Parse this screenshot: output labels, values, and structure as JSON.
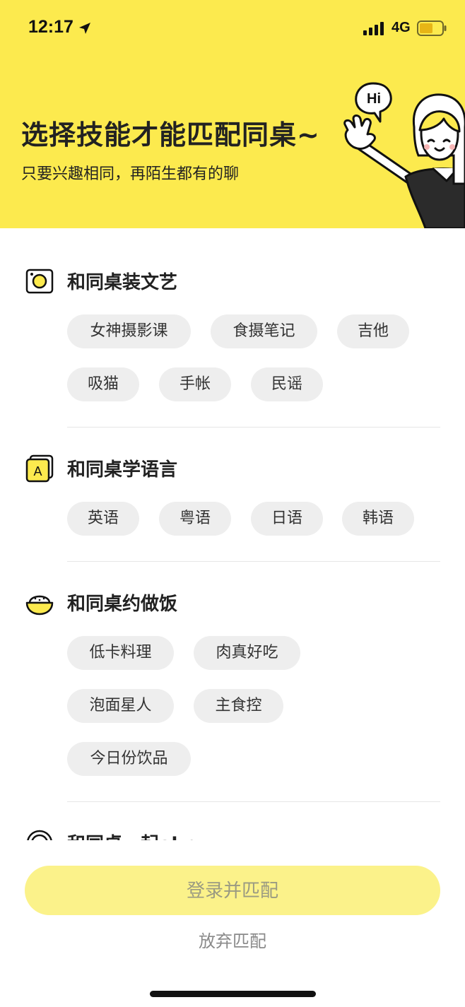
{
  "status_bar": {
    "time": "12:17",
    "network": "4G"
  },
  "header": {
    "title": "选择技能才能匹配同桌~",
    "subtitle": "只要兴趣相同，再陌生都有的聊",
    "mascot_bubble": "Hi"
  },
  "sections": [
    {
      "title": "和同桌装文艺",
      "icon": "camera-icon",
      "tags": [
        "女神摄影课",
        "食摄笔记",
        "吉他",
        "吸猫",
        "手帐",
        "民谣"
      ]
    },
    {
      "title": "和同桌学语言",
      "icon": "letter-a-icon",
      "tags": [
        "英语",
        "粤语",
        "日语",
        "韩语"
      ]
    },
    {
      "title": "和同桌约做饭",
      "icon": "rice-bowl-icon",
      "tags": [
        "低卡料理",
        "肉真好吃",
        "泡面星人",
        "主食控",
        "今日份饮品"
      ]
    },
    {
      "title": "和同桌一起akr",
      "icon": "ring-icon",
      "tags": []
    }
  ],
  "footer": {
    "login_button": "登录并匹配",
    "abandon_link": "放弃匹配"
  },
  "colors": {
    "brand_yellow": "#FCEA4E",
    "button_yellow": "#FBF28A",
    "tag_bg": "#EEEEEE"
  }
}
